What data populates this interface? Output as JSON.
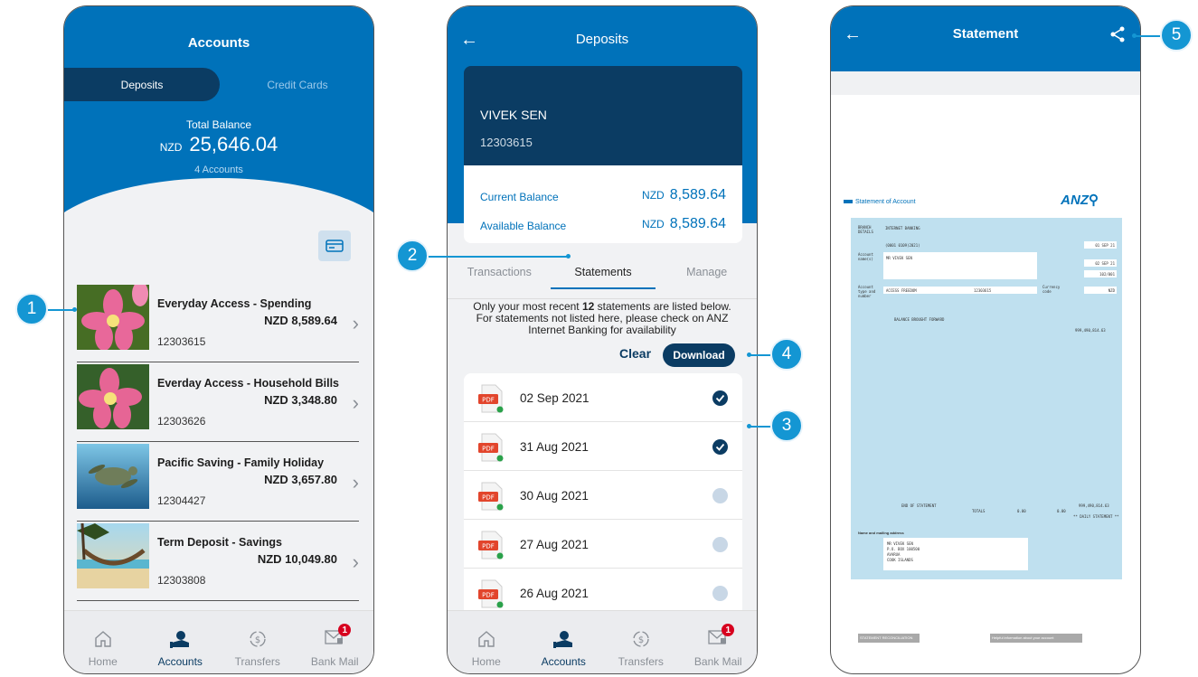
{
  "screen1": {
    "title": "Accounts",
    "seg_active": "Deposits",
    "seg_inactive": "Credit Cards",
    "total_label": "Total Balance",
    "currency": "NZD",
    "total_amount": "25,646.04",
    "accounts_count": "4 Accounts",
    "accounts": [
      {
        "name": "Everyday Access - Spending",
        "amount": "NZD 8,589.64",
        "number": "12303615",
        "image": "pink-flower"
      },
      {
        "name": "Everday Access - Household Bills",
        "amount": "NZD 3,348.80",
        "number": "12303626",
        "image": "pink-flower"
      },
      {
        "name": "Pacific Saving - Family Holiday",
        "amount": "NZD 3,657.80",
        "number": "12304427",
        "image": "sea-turtle"
      },
      {
        "name": "Term Deposit - Savings",
        "amount": "NZD 10,049.80",
        "number": "12303808",
        "image": "hammock-beach"
      }
    ]
  },
  "tabbar": {
    "home": "Home",
    "accounts": "Accounts",
    "transfers": "Transfers",
    "bankmail": "Bank Mail",
    "badge": "1"
  },
  "screen2": {
    "title": "Deposits",
    "holder": "VIVEK SEN",
    "account_no": "12303615",
    "current_label": "Current Balance",
    "available_label": "Available Balance",
    "currency": "NZD",
    "current_value": "8,589.64",
    "available_value": "8,589.64",
    "tabs": [
      "Transactions",
      "Statements",
      "Manage"
    ],
    "info_pre": "Only your most recent ",
    "info_count": "12",
    "info_post": " statements are listed below. For statements not listed here, please check on ANZ Internet Banking for availability",
    "clear": "Clear",
    "download": "Download",
    "pdf_label": "PDF",
    "statements": [
      {
        "date": "02 Sep 2021",
        "checked": true
      },
      {
        "date": "31 Aug 2021",
        "checked": true
      },
      {
        "date": "30 Aug 2021",
        "checked": false
      },
      {
        "date": "27 Aug 2021",
        "checked": false
      },
      {
        "date": "26 Aug 2021",
        "checked": false
      }
    ]
  },
  "screen3": {
    "title": "Statement",
    "doc_title": "Statement of Account",
    "brand": "ANZ",
    "branch_label": "BRANCH DETAILS",
    "branch_value": "INTERNET BANKING",
    "bsb": "(0001 0109)2021)",
    "account_name_label": "Account name(s)",
    "account_name": "MR VIVEK SEN",
    "date_from": "01 SEP 21",
    "date_to": "02 SEP 21",
    "page_no": "102/001",
    "acct_type_label": "Account type and number",
    "acct_type": "ACCESS FREEDOM",
    "acct_no": "12303615",
    "currency_label": "Currency code",
    "currency": "NZD",
    "opening": "BALANCE BROUGHT FORWARD",
    "opening_amt": "999,490,814.63",
    "end_label": "END OF STATEMENT",
    "totals": "TOTALS",
    "zero": "0.00",
    "daily": "** DAILY STATEMENT **",
    "address_label": "Name and mailing address",
    "address": [
      "MR VIVEK SEN",
      "P.O. BOX 100500",
      "AVARUA",
      "COOK ISLANDS"
    ],
    "recon": "STATEMENT RECONCILIATION",
    "help": "Helpful information about your account"
  },
  "callouts": [
    "1",
    "2",
    "3",
    "4",
    "5"
  ]
}
